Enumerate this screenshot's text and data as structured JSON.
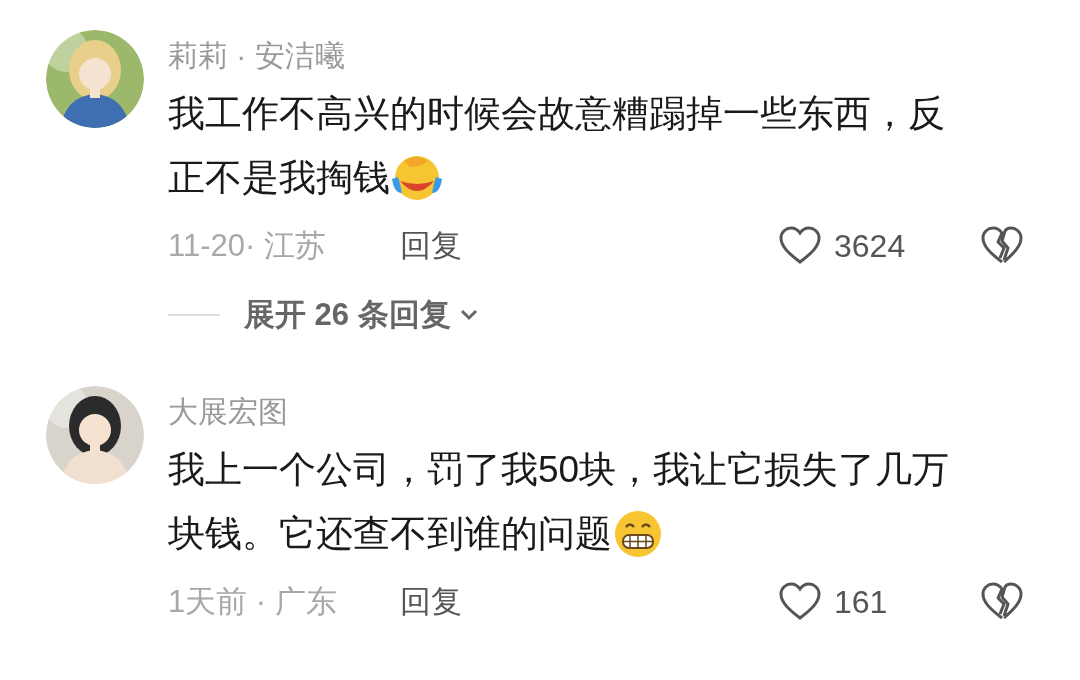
{
  "comments": [
    {
      "author": "莉莉 · 安洁曦",
      "text_lines": [
        "我工作不高兴的时候会故意糟蹋掉一些东西，反",
        "正不是我掏钱"
      ],
      "emoji": {
        "kind": "tears-of-joy"
      },
      "meta": "11-20· 江苏",
      "reply": "回复",
      "likes": "3624",
      "expand_replies": "展开 26 条回复"
    },
    {
      "author": "大展宏图",
      "text_lines": [
        "我上一个公司，罚了我50块，我让它损失了几万",
        "块钱。它还查不到谁的问题"
      ],
      "emoji": {
        "kind": "grin"
      },
      "meta": "1天前 · 广东",
      "reply": "回复",
      "likes": "161"
    }
  ]
}
